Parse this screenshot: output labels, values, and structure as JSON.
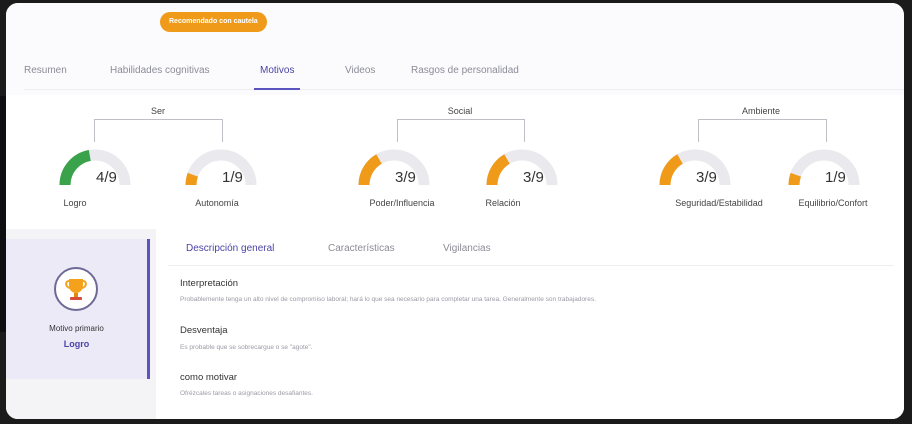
{
  "badge": "Recomendado con cautela",
  "tabs": [
    "Resumen",
    "Habilidades cognitivas",
    "Motivos",
    "Videos",
    "Rasgos de personalidad"
  ],
  "active_tab": "Motivos",
  "groups": [
    {
      "label": "Ser",
      "gauges": [
        {
          "value": "4/9",
          "label": "Logro",
          "score": 4,
          "max": 9,
          "color": "#3aa24a"
        },
        {
          "value": "1/9",
          "label": "Autonomía",
          "score": 1,
          "max": 9,
          "color": "#f09a1a"
        }
      ]
    },
    {
      "label": "Social",
      "gauges": [
        {
          "value": "3/9",
          "label": "Poder/Influencia",
          "score": 3,
          "max": 9,
          "color": "#f09a1a"
        },
        {
          "value": "3/9",
          "label": "Relación",
          "score": 3,
          "max": 9,
          "color": "#f09a1a"
        }
      ]
    },
    {
      "label": "Ambiente",
      "gauges": [
        {
          "value": "3/9",
          "label": "Seguridad/Estabilidad",
          "score": 3,
          "max": 9,
          "color": "#f09a1a"
        },
        {
          "value": "1/9",
          "label": "Equilibrio/Confort",
          "score": 1,
          "max": 9,
          "color": "#f09a1a"
        }
      ]
    }
  ],
  "primary": {
    "label": "Motivo primario",
    "value": "Logro",
    "icon": "trophy-icon"
  },
  "detail_tabs": [
    "Descripción general",
    "Características",
    "Vigilancias"
  ],
  "active_detail_tab": "Descripción general",
  "sections": [
    {
      "title": "Interpretación",
      "text": "Probablemente tenga un alto nivel de compromiso laboral; hará lo que sea necesario para completar una tarea. Generalmente son trabajadores."
    },
    {
      "title": "Desventaja",
      "text": "Es probable que se sobrecargue o se \"agote\"."
    },
    {
      "title": "como motivar",
      "text": "Ofrézcales tareas o asignaciones desafiantes."
    }
  ]
}
